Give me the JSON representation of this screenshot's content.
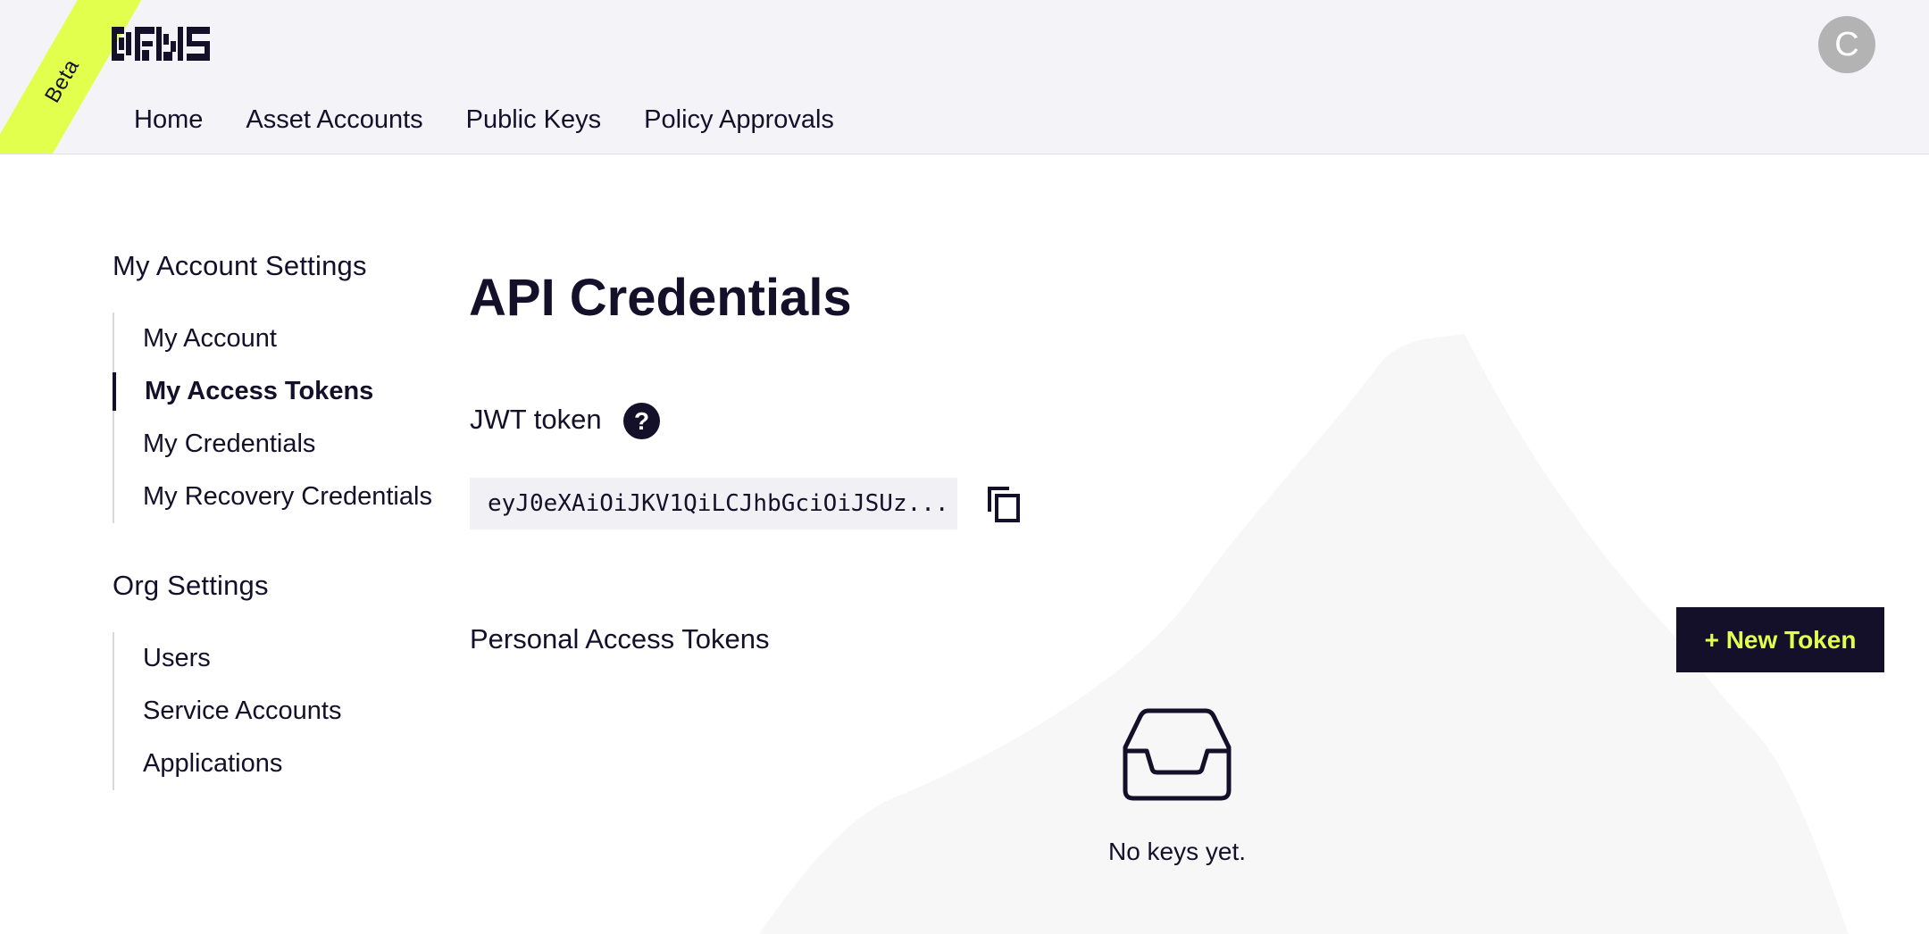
{
  "header": {
    "beta_label": "Beta",
    "logo_text": "DFNS",
    "avatar_initial": "C",
    "nav": [
      {
        "label": "Home"
      },
      {
        "label": "Asset Accounts"
      },
      {
        "label": "Public Keys"
      },
      {
        "label": "Policy Approvals"
      }
    ]
  },
  "sidebar": {
    "account_heading": "My Account Settings",
    "account_items": [
      {
        "label": "My Account"
      },
      {
        "label": "My Access Tokens",
        "active": true
      },
      {
        "label": "My Credentials"
      },
      {
        "label": "My Recovery Credentials"
      }
    ],
    "org_heading": "Org Settings",
    "org_items": [
      {
        "label": "Users"
      },
      {
        "label": "Service Accounts"
      },
      {
        "label": "Applications"
      }
    ]
  },
  "main": {
    "title": "API Credentials",
    "jwt_label": "JWT token",
    "help_glyph": "?",
    "jwt_value": "eyJ0eXAiOiJKV1QiLCJhbGciOiJSUz...",
    "pat_heading": "Personal Access Tokens",
    "new_token_label": "+ New Token",
    "empty_text": "No keys yet."
  },
  "colors": {
    "accent": "#e2ff4d",
    "ink": "#14102a",
    "header_bg": "#f4f4f8",
    "avatar_bg": "#b3b3b3"
  },
  "icons": [
    "logo-icon",
    "help-icon",
    "copy-icon",
    "inbox-icon"
  ]
}
